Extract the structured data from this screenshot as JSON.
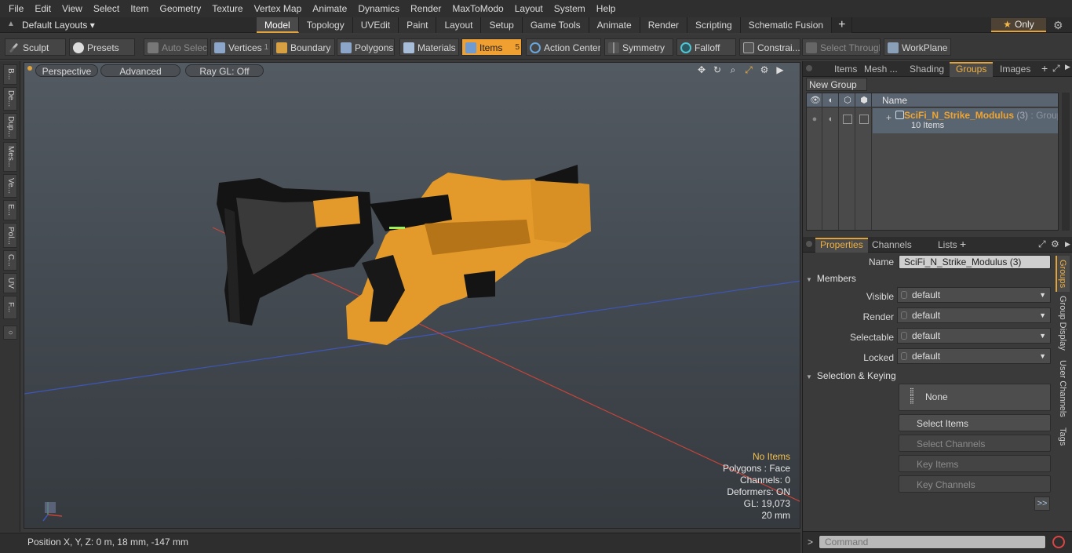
{
  "menu": [
    "File",
    "Edit",
    "View",
    "Select",
    "Item",
    "Geometry",
    "Texture",
    "Vertex Map",
    "Animate",
    "Dynamics",
    "Render",
    "MaxToModo",
    "Layout",
    "System",
    "Help"
  ],
  "layouts_label": "Default Layouts",
  "mode_tabs": [
    {
      "label": "Model",
      "active": true
    },
    {
      "label": "Topology"
    },
    {
      "label": "UVEdit"
    },
    {
      "label": "Paint"
    },
    {
      "label": "Layout"
    },
    {
      "label": "Setup"
    },
    {
      "label": "Game Tools"
    },
    {
      "label": "Animate"
    },
    {
      "label": "Render"
    },
    {
      "label": "Scripting"
    },
    {
      "label": "Schematic Fusion"
    }
  ],
  "only_label": "Only",
  "toolbar": {
    "sculpt": "Sculpt",
    "presets": "Presets",
    "auto_select": "Auto Select",
    "vertices": "Vertices",
    "vertices_count": "1",
    "boundary": "Boundary",
    "polygons": "Polygons",
    "materials": "Materials",
    "items": "Items",
    "items_count": "5",
    "action_center": "Action Center",
    "symmetry": "Symmetry",
    "falloff": "Falloff",
    "constraints": "Constrai...",
    "select_through": "Select Through",
    "workplane": "WorkPlane"
  },
  "left_tools": [
    "B...",
    "De...",
    "Dup...",
    "Mes...",
    "Ve...",
    "E...",
    "Pol...",
    "C...",
    "UV",
    "F..."
  ],
  "viewport": {
    "view": "Perspective",
    "style": "Advanced",
    "raygl": "Ray GL: Off",
    "info": {
      "items": "No Items",
      "polygons": "Polygons : Face",
      "channels": "Channels: 0",
      "deformers": "Deformers: ON",
      "gl": "GL: 19,073",
      "scale": "20 mm"
    }
  },
  "status_text": "Position X, Y, Z:   0 m, 18 mm, -147 mm",
  "right_tabs": [
    "Items",
    "Mesh ...",
    "Shading",
    "Groups",
    "Images"
  ],
  "right_active_tab": "Groups",
  "new_group": "New Group",
  "group_list": {
    "col_name": "Name",
    "group_name": "SciFi_N_Strike_Modulus",
    "group_count": "(3)",
    "group_type": ": Group",
    "group_items": "10 Items"
  },
  "prop_tabs": [
    "Properties",
    "Channels",
    "Lists"
  ],
  "properties": {
    "name_label": "Name",
    "name_value": "SciFi_N_Strike_Modulus (3)",
    "members_section": "Members",
    "visible_label": "Visible",
    "visible_value": "default",
    "render_label": "Render",
    "render_value": "default",
    "selectable_label": "Selectable",
    "selectable_value": "default",
    "locked_label": "Locked",
    "locked_value": "default",
    "keying_section": "Selection & Keying",
    "none_btn": "None",
    "select_items": "Select Items",
    "select_channels": "Select Channels",
    "key_items": "Key Items",
    "key_channels": "Key Channels",
    "expand": ">>"
  },
  "side_vtabs": [
    "Groups",
    "Group Display",
    "User Channels",
    "Tags"
  ],
  "command_placeholder": "Command",
  "colors": {
    "accent": "#e3a33b",
    "gun_orange": "#e39a2a",
    "gun_black": "#121212",
    "axis_red": "#c8443a",
    "axis_blue": "#3f56b8"
  }
}
